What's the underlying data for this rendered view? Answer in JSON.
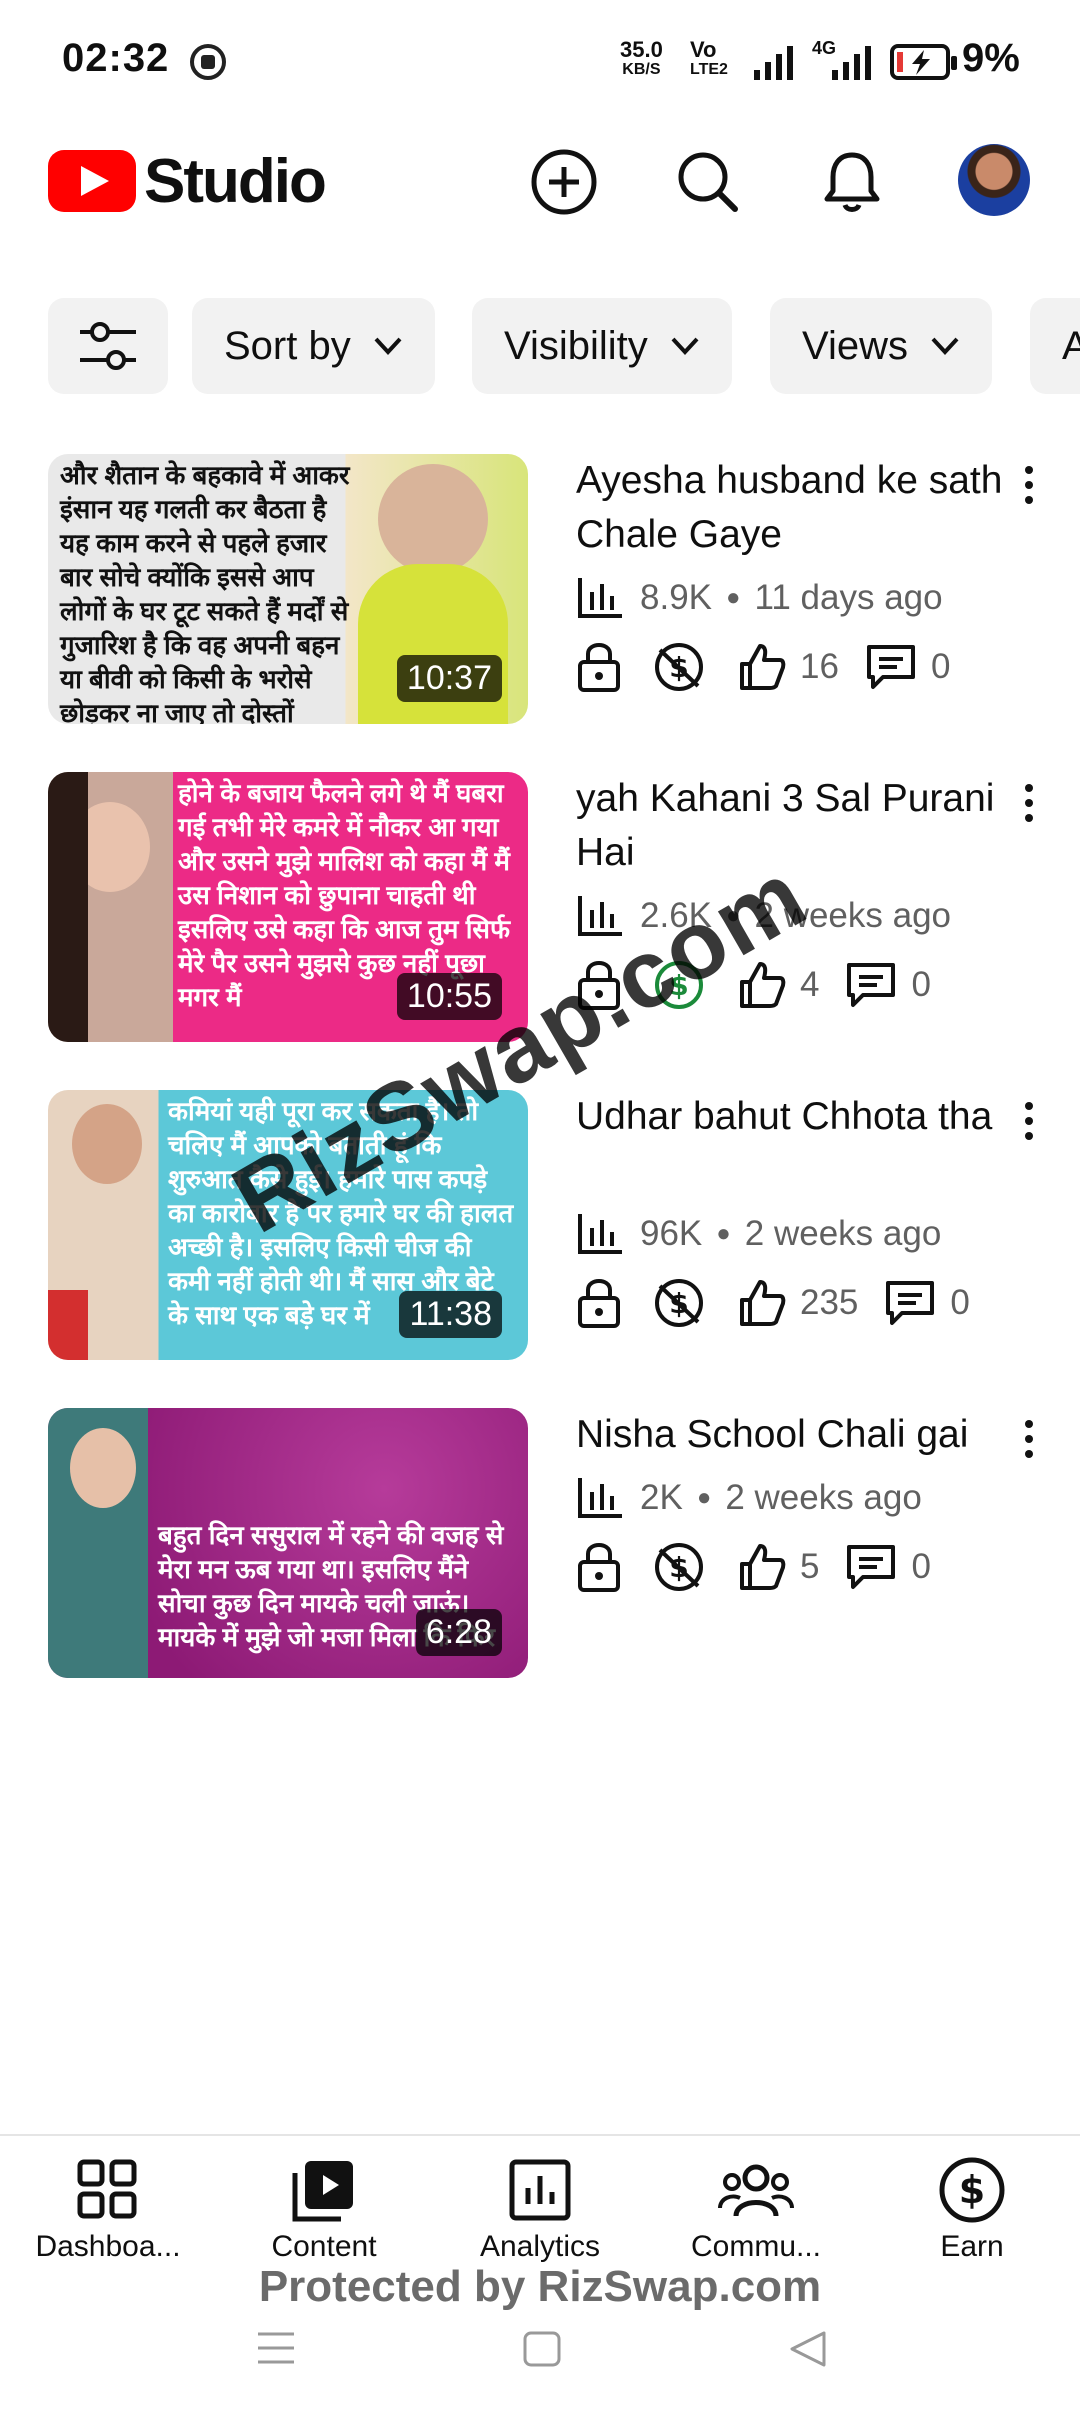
{
  "status_bar": {
    "time": "02:32",
    "net_speed_top": "35.0",
    "net_speed_unit": "KB/S",
    "volte_top": "Vo",
    "volte_bottom": "LTE2",
    "network_type": "4G",
    "battery": "9%"
  },
  "header": {
    "app_name": "Studio",
    "icons": [
      "add-icon",
      "search-icon",
      "bell-icon"
    ],
    "brand_color": "#ff0000"
  },
  "filters": [
    {
      "label": ""
    },
    {
      "label": "Sort by"
    },
    {
      "label": "Visibility"
    },
    {
      "label": "Views"
    },
    {
      "label": "A"
    }
  ],
  "videos": [
    {
      "title": "Ayesha husband ke sath Chale Gaye",
      "views": "8.9K",
      "age": "11 days ago",
      "likes": "16",
      "comments": "0",
      "duration": "10:37",
      "monetized": false,
      "thumb_text": "और शैतान के बहकावे में आकर इंसान यह गलती कर बैठता है यह काम करने से पहले हजार बार सोचे क्योंकि इससे आप लोगों के घर टूट सकते हैं मर्दों से गुजारिश है कि वह अपनी बहन या बीवी को किसी के भरोसे छोड़कर ना जाए तो दोस्तों",
      "thumb_bg": "#e8e8e8"
    },
    {
      "title": "yah Kahani 3 Sal Purani Hai",
      "views": "2.6K",
      "age": "2 weeks ago",
      "likes": "4",
      "comments": "0",
      "duration": "10:55",
      "monetized": true,
      "thumb_text": "होने के बजाय फैलने लगे थे मैं घबरा गई तभी मेरे कमरे में नौकर आ गया और उसने मुझे मालिश को कहा मैं मैं उस निशान को छुपाना चाहती थी इसलिए उसे कहा कि आज तुम सिर्फ मेरे पैर उसने मुझसे कुछ नहीं पूछा मगर मैं",
      "thumb_bg": "#ec2a86"
    },
    {
      "title": "Udhar bahut Chhota tha",
      "views": "96K",
      "age": "2 weeks ago",
      "likes": "235",
      "comments": "0",
      "duration": "11:38",
      "monetized": false,
      "thumb_text": "कमियां यही पूरा कर सकता है। तो चलिए मैं आपको बताती हूं कि शुरुआत कैसे हुई। हमारे पास कपड़े का कारोबार है पर हमारे घर की हालत अच्छी है। इसलिए किसी चीज की कमी नहीं होती थी। मैं सास और बेटे के साथ एक बड़े घर में",
      "thumb_bg": "#5cc8d8"
    },
    {
      "title": "Nisha School Chali gai",
      "views": "2K",
      "age": "2 weeks ago",
      "likes": "5",
      "comments": "0",
      "duration": "6:28",
      "monetized": false,
      "thumb_text": "बहुत दिन ससुराल में रहने की वजह से मेरा मन ऊब गया था। इसलिए मैंने सोचा कुछ दिन मायके चली जाऊं। मायके में मुझे जो मजा मिला कि फिर",
      "thumb_bg": "#9c1d7c"
    }
  ],
  "bottom_nav": [
    {
      "label": "Dashboa...",
      "icon": "dashboard-icon"
    },
    {
      "label": "Content",
      "icon": "content-icon"
    },
    {
      "label": "Analytics",
      "icon": "analytics-icon"
    },
    {
      "label": "Commu...",
      "icon": "community-icon"
    },
    {
      "label": "Earn",
      "icon": "earn-icon"
    }
  ],
  "watermark": {
    "text": "RizSwap.com",
    "footer": "Protected by RizSwap.com"
  }
}
